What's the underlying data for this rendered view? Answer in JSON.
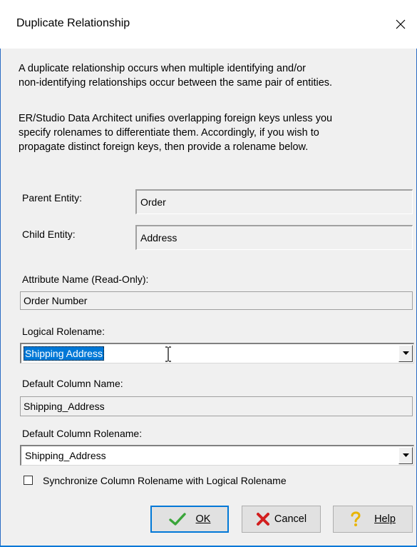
{
  "dialog": {
    "title": "Duplicate Relationship",
    "description_1_line1": "A duplicate relationship occurs when multiple identifying and/or",
    "description_1_line2": "non-identifying relationships occur between the same pair of entities.",
    "description_2_line1": "ER/Studio Data Architect unifies overlapping foreign keys unless you",
    "description_2_line2": "specify rolenames to differentiate them.  Accordingly, if you wish to",
    "description_2_line3": "propagate distinct foreign keys, then provide a rolename below."
  },
  "fields": {
    "parent_entity_label": "Parent Entity:",
    "parent_entity_value": "Order",
    "child_entity_label": "Child Entity:",
    "child_entity_value": "Address",
    "attribute_name_label": "Attribute Name (Read-Only):",
    "attribute_name_value": "Order Number",
    "logical_rolename_label": "Logical Rolename:",
    "logical_rolename_value": "Shipping Address",
    "default_column_name_label": "Default Column Name:",
    "default_column_name_value": "Shipping_Address",
    "default_column_rolename_label": "Default Column Rolename:",
    "default_column_rolename_value": "Shipping_Address",
    "sync_checkbox_label": "Synchronize Column Rolename with Logical Rolename",
    "sync_checked": false
  },
  "buttons": {
    "ok_label": "OK",
    "cancel_label": "Cancel",
    "help_label": "Help"
  },
  "icons": {
    "close": "close-icon",
    "ok": "checkmark-icon",
    "cancel": "red-x-icon",
    "help": "question-mark-icon",
    "dropdown": "chevron-down-icon",
    "cursor": "text-cursor-icon"
  },
  "colors": {
    "selection": "#0078d7",
    "window_border": "#2b6cc4",
    "ok_check": "#3aa53a",
    "cancel_x": "#d21e1e",
    "help_q": "#e8b400"
  }
}
